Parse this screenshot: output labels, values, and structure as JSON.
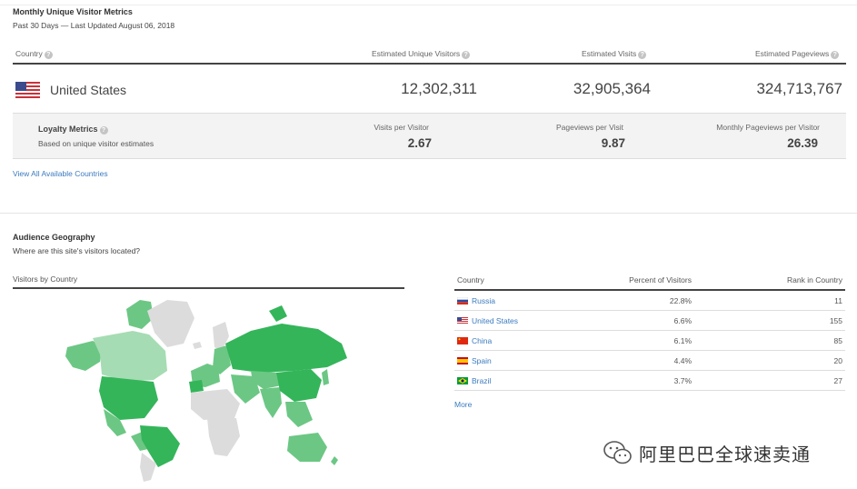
{
  "metrics": {
    "title": "Monthly Unique Visitor Metrics",
    "subtitle": "Past 30 Days — Last Updated August 06, 2018",
    "headers": {
      "country": "Country",
      "unique_visitors": "Estimated Unique Visitors",
      "visits": "Estimated Visits",
      "pageviews": "Estimated Pageviews"
    },
    "row": {
      "country": "United States",
      "unique_visitors": "12,302,311",
      "visits": "32,905,364",
      "pageviews": "324,713,767"
    },
    "loyalty": {
      "title": "Loyalty Metrics",
      "subtitle": "Based on unique visitor estimates",
      "visits_per_visitor_label": "Visits per Visitor",
      "visits_per_visitor": "2.67",
      "pageviews_per_visit_label": "Pageviews per Visit",
      "pageviews_per_visit": "9.87",
      "monthly_pageviews_label": "Monthly Pageviews per Visitor",
      "monthly_pageviews": "26.39"
    },
    "view_all_link": "View All Available Countries"
  },
  "geography": {
    "title": "Audience Geography",
    "subtitle": "Where are this site's visitors located?",
    "map_label": "Visitors by Country",
    "table": {
      "headers": {
        "country": "Country",
        "percent": "Percent of Visitors",
        "rank": "Rank in Country"
      },
      "rows": [
        {
          "country": "Russia",
          "percent": "22.8%",
          "rank": "11",
          "flag": "russia-flag"
        },
        {
          "country": "United States",
          "percent": "6.6%",
          "rank": "155",
          "flag": "us-flag"
        },
        {
          "country": "China",
          "percent": "6.1%",
          "rank": "85",
          "flag": "china-flag"
        },
        {
          "country": "Spain",
          "percent": "4.4%",
          "rank": "20",
          "flag": "spain-flag"
        },
        {
          "country": "Brazil",
          "percent": "3.7%",
          "rank": "27",
          "flag": "brazil-flag"
        }
      ]
    },
    "more_link": "More"
  },
  "watermark": {
    "text": "阿里巴巴全球速卖通",
    "icon": "wechat-icon"
  },
  "colors": {
    "link": "#3b7bbf",
    "map_strong": "#34b55a",
    "map_medium": "#6cc784",
    "map_light": "#a6dcb3",
    "map_none": "#dcdcdc"
  }
}
